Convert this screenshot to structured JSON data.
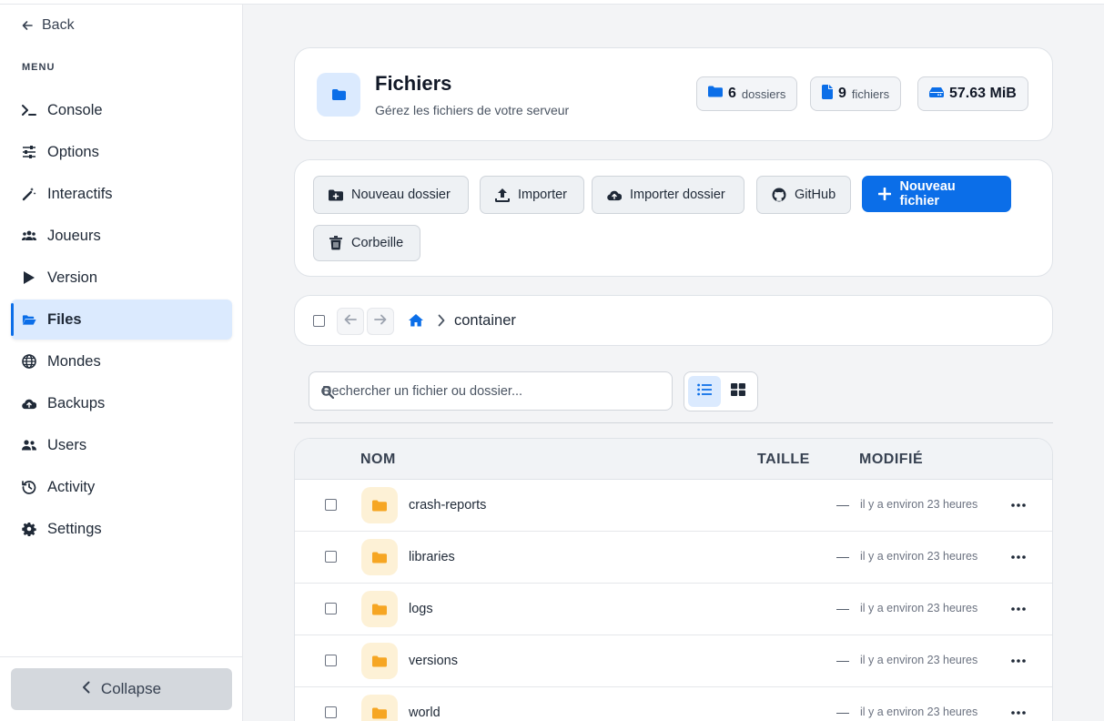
{
  "sidebar": {
    "back_label": "Back",
    "menu_label": "MENU",
    "items": [
      {
        "label": "Console",
        "icon": "terminal-icon"
      },
      {
        "label": "Options",
        "icon": "sliders-icon"
      },
      {
        "label": "Interactifs",
        "icon": "magic-wand-icon"
      },
      {
        "label": "Joueurs",
        "icon": "users-group-icon"
      },
      {
        "label": "Version",
        "icon": "play-icon"
      },
      {
        "label": "Files",
        "icon": "folder-open-icon",
        "active": true
      },
      {
        "label": "Mondes",
        "icon": "globe-icon"
      },
      {
        "label": "Backups",
        "icon": "cloud-upload-icon"
      },
      {
        "label": "Users",
        "icon": "users-icon"
      },
      {
        "label": "Activity",
        "icon": "history-icon"
      },
      {
        "label": "Settings",
        "icon": "gear-icon"
      }
    ],
    "collapse_label": "Collapse"
  },
  "header": {
    "title": "Fichiers",
    "subtitle": "Gérez les fichiers de votre serveur",
    "stats": {
      "folders_count": "6",
      "folders_label": "dossiers",
      "files_count": "9",
      "files_label": "fichiers",
      "size": "57.63 MiB"
    }
  },
  "actions": {
    "new_folder": "Nouveau dossier",
    "import": "Importer",
    "import_folder": "Importer dossier",
    "github": "GitHub",
    "new_file": "Nouveau fichier",
    "trash": "Corbeille"
  },
  "breadcrumb": {
    "current": "container"
  },
  "search": {
    "placeholder": "Rechercher un fichier ou dossier..."
  },
  "table": {
    "columns": {
      "name": "NOM",
      "size": "TAILLE",
      "modified": "MODIFIÉ"
    },
    "rows": [
      {
        "name": "crash-reports",
        "size": "—",
        "modified": "il y a environ 23 heures"
      },
      {
        "name": "libraries",
        "size": "—",
        "modified": "il y a environ 23 heures"
      },
      {
        "name": "logs",
        "size": "—",
        "modified": "il y a environ 23 heures"
      },
      {
        "name": "versions",
        "size": "—",
        "modified": "il y a environ 23 heures"
      },
      {
        "name": "world",
        "size": "—",
        "modified": "il y a environ 23 heures"
      }
    ]
  },
  "colors": {
    "accent": "#0b6ee8",
    "folder": "#f6a623",
    "active_bg": "#dbeafe"
  }
}
